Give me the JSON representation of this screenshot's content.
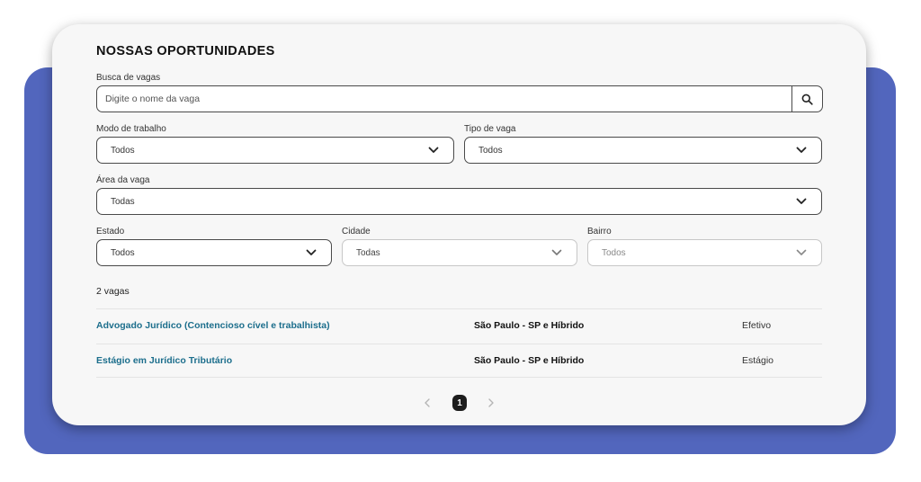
{
  "header": {
    "title": "NOSSAS OPORTUNIDADES"
  },
  "search": {
    "label": "Busca de vagas",
    "placeholder": "Digite o nome da vaga"
  },
  "filters": {
    "modo": {
      "label": "Modo de trabalho",
      "value": "Todos"
    },
    "tipo": {
      "label": "Tipo de vaga",
      "value": "Todos"
    },
    "area": {
      "label": "Área da vaga",
      "value": "Todas"
    },
    "estado": {
      "label": "Estado",
      "value": "Todos"
    },
    "cidade": {
      "label": "Cidade",
      "value": "Todas"
    },
    "bairro": {
      "label": "Bairro",
      "value": "Todos"
    }
  },
  "results": {
    "count_label": "2 vagas",
    "jobs": [
      {
        "title": "Advogado Jurídico (Contencioso cível e trabalhista)",
        "location": "São Paulo - SP e Híbrido",
        "type": "Efetivo"
      },
      {
        "title": "Estágio em Jurídico Tributário",
        "location": "São Paulo - SP e Híbrido",
        "type": "Estágio"
      }
    ]
  },
  "pagination": {
    "current": "1"
  },
  "colors": {
    "backdrop": "#5266bd",
    "card": "#f7f7f7",
    "link": "#1c6e8c"
  },
  "icons": {
    "search": "search-icon",
    "dropdown": "chevron-down-icon",
    "prev": "chevron-left-icon",
    "next": "chevron-right-icon"
  }
}
